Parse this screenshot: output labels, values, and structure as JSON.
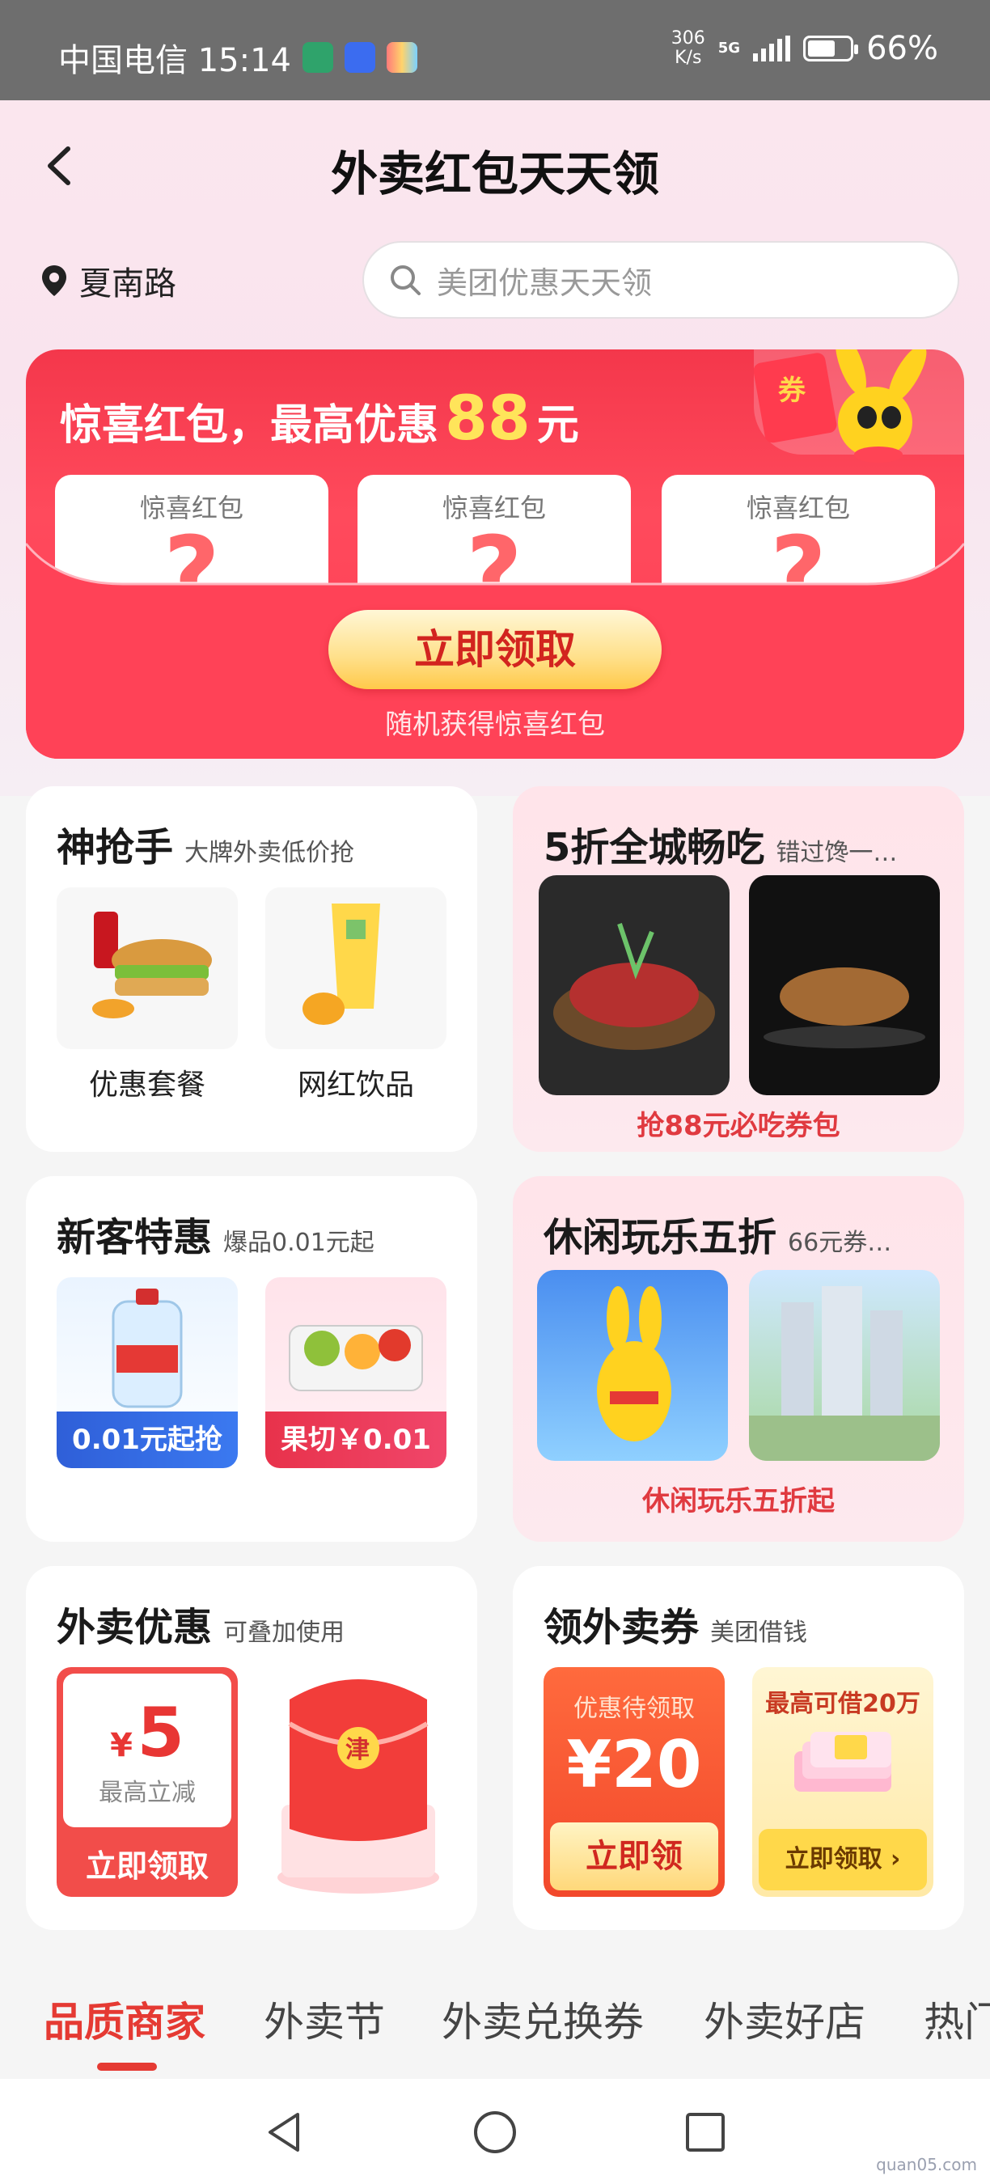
{
  "status_bar": {
    "carrier_time": "中国电信 15:14",
    "speed_value": "306",
    "speed_unit": "K/s",
    "network": "5G",
    "battery": "66%",
    "battery_level": 0.66
  },
  "nav": {
    "title": "外卖红包天天领"
  },
  "location": {
    "text": "夏南路"
  },
  "search": {
    "placeholder": "美团优惠天天领"
  },
  "promo": {
    "title_prefix": "惊喜红包，最高优惠",
    "amount": "88",
    "unit": "元",
    "mascot_tag": "券",
    "slots": [
      {
        "label": "惊喜红包",
        "mark": "?"
      },
      {
        "label": "惊喜红包",
        "mark": "?"
      },
      {
        "label": "惊喜红包",
        "mark": "?"
      }
    ],
    "cta": "立即领取",
    "cta_sub": "随机获得惊喜红包"
  },
  "cards": {
    "grabber": {
      "title": "神抢手",
      "subtitle": "大牌外卖低价抢",
      "items": [
        "优惠套餐",
        "网红饮品"
      ]
    },
    "half_city": {
      "title": "5折全城畅吃",
      "subtitle": "错过馋一…",
      "footer": "抢88元必吃券包"
    },
    "new_user": {
      "title": "新客特惠",
      "subtitle": "爆品0.01元起",
      "items": [
        "0.01元起抢",
        "果切￥0.01"
      ]
    },
    "leisure": {
      "title": "休闲玩乐五折",
      "subtitle": "66元券…",
      "footer": "休闲玩乐五折起"
    },
    "delivery_deal": {
      "title": "外卖优惠",
      "subtitle": "可叠加使用",
      "currency": "¥",
      "amount": "5",
      "note": "最高立减",
      "button": "立即领取",
      "envelope_mark": "津"
    },
    "coupon": {
      "title": "领外卖券",
      "subtitle": "美团借钱",
      "left_top": "优惠待领取",
      "left_amount": "¥20",
      "left_button": "立即领",
      "right_top": "最高可借20万",
      "right_button": "立即领取 ›"
    }
  },
  "tabs": [
    "品质商家",
    "外卖节",
    "外卖兑换券",
    "外卖好店",
    "热门"
  ],
  "watermark": "quan05.com"
}
